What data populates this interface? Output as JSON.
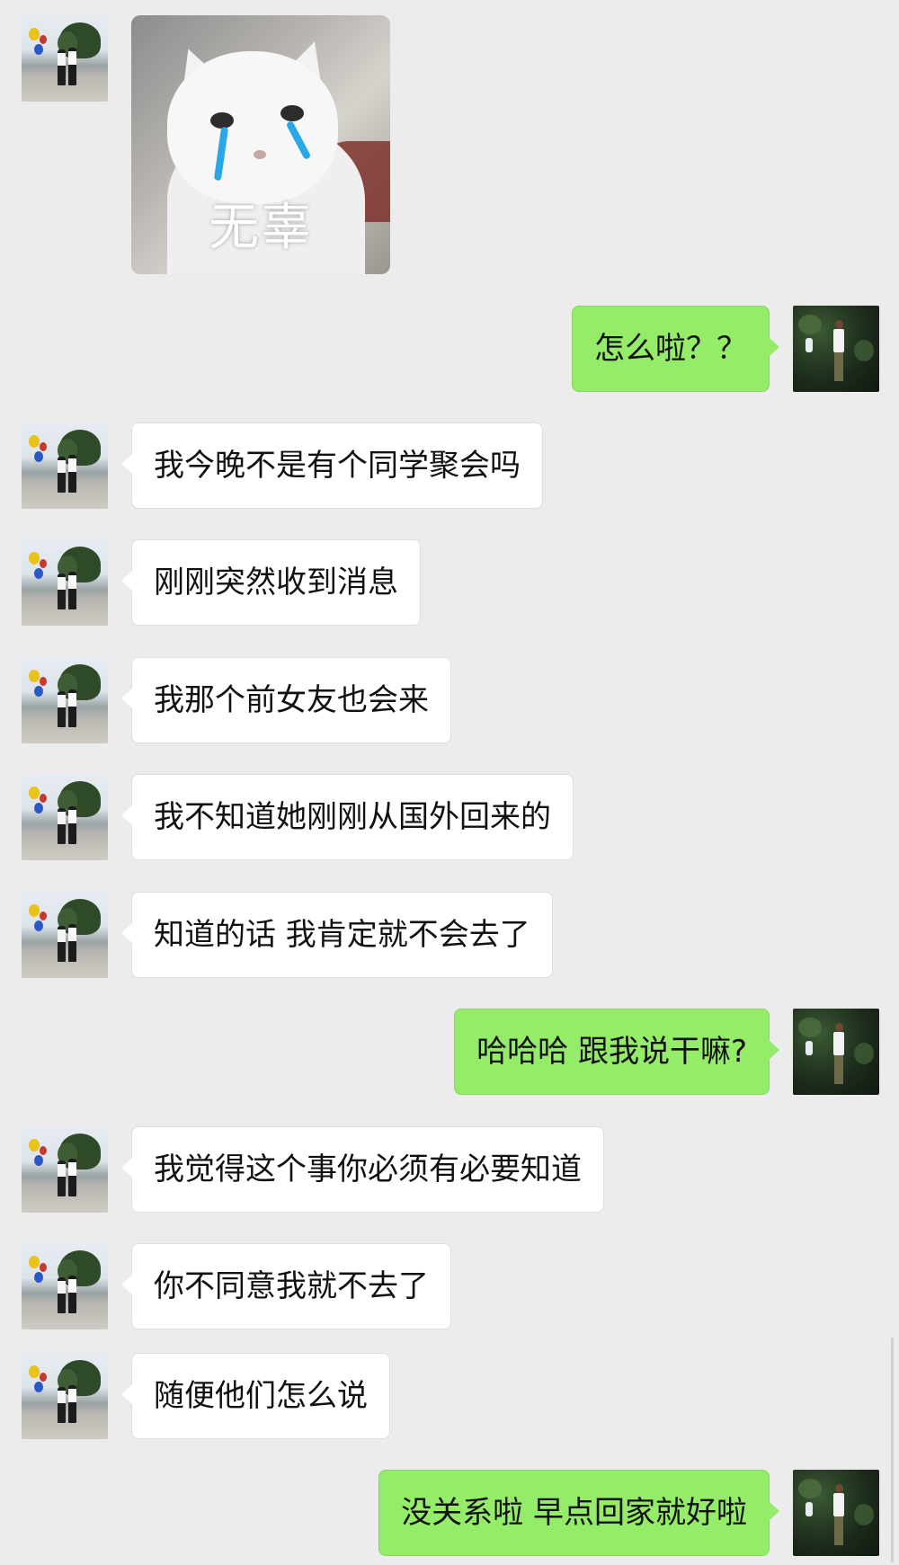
{
  "sticker": {
    "caption": "无辜",
    "icon": "crying-cat-sticker"
  },
  "messages": [
    {
      "side": "right",
      "text": "怎么啦？？"
    },
    {
      "side": "left",
      "text": "我今晚不是有个同学聚会吗"
    },
    {
      "side": "left",
      "text": "刚刚突然收到消息"
    },
    {
      "side": "left",
      "text": "我那个前女友也会来"
    },
    {
      "side": "left",
      "text": "我不知道她刚刚从国外回来的"
    },
    {
      "side": "left",
      "text": "知道的话 我肯定就不会去了"
    },
    {
      "side": "right",
      "text": "哈哈哈 跟我说干嘛?"
    },
    {
      "side": "left",
      "text": "我觉得这个事你必须有必要知道"
    },
    {
      "side": "left",
      "text": "你不同意我就不去了"
    },
    {
      "side": "left",
      "text": "随便他们怎么说"
    },
    {
      "side": "right",
      "text": "没关系啦  早点回家就好啦"
    }
  ],
  "colors": {
    "background": "#ececec",
    "incoming_bubble": "#ffffff",
    "outgoing_bubble": "#95ec69"
  }
}
